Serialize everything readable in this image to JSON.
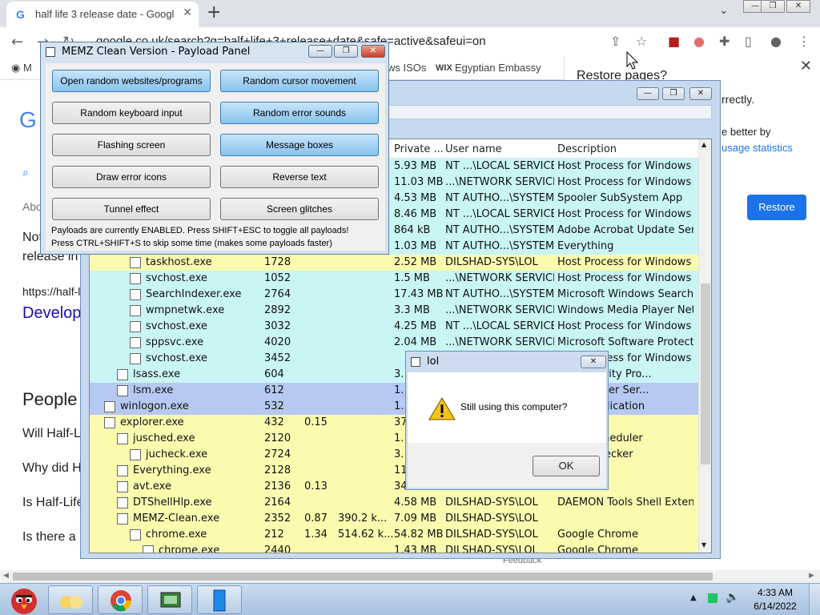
{
  "chrome": {
    "tab_title": "half life 3 release date - Googl",
    "tab_close": "✕",
    "new_tab": "+",
    "url": "google.co.uk/search?q=half+life+3+release+date&safe=active&safeui=on",
    "bookmarks": [
      "M",
      "ws ISOs",
      "Egyptian Embassy"
    ],
    "bookmark_wix": "WIX"
  },
  "page_behind": {
    "google_letter": "G",
    "about": "Abo",
    "not": "Not",
    "release": "release in",
    "url_snip": "https://half-l",
    "develop": "Develop",
    "people": "People",
    "q1": "Will Half-L",
    "q2": "Why did H",
    "q3": "Is Half-Life",
    "q4": "Is there a",
    "feedback": "Feedback"
  },
  "restore": {
    "title": "Restore pages?",
    "line1": "rrectly.",
    "line2": "e better by",
    "link": "usage statistics",
    "button": "Restore"
  },
  "taskmgr": {
    "columns": {
      "private": "Private ...",
      "user": "User name",
      "description": "Description"
    },
    "rows": [
      {
        "name": "",
        "pid": "",
        "cpu": "",
        "ws": "",
        "priv": "5.93 MB",
        "user": "NT ...\\LOCAL SERVICE",
        "desc": "Host Process for Windows ...",
        "color": "#c9f5f5",
        "indent": 2
      },
      {
        "name": "",
        "pid": "",
        "cpu": "",
        "ws": "",
        "priv": "11.03 MB",
        "user": "...\\NETWORK SERVICE",
        "desc": "Host Process for Windows ...",
        "color": "#c9f5f5",
        "indent": 2
      },
      {
        "name": "",
        "pid": "",
        "cpu": "",
        "ws": "",
        "priv": "4.53 MB",
        "user": "NT AUTHO...\\SYSTEM",
        "desc": "Spooler SubSystem App",
        "color": "#c9f5f5",
        "indent": 2
      },
      {
        "name": "",
        "pid": "",
        "cpu": "",
        "ws": "",
        "priv": "8.46 MB",
        "user": "NT ...\\LOCAL SERVICE",
        "desc": "Host Process for Windows ...",
        "color": "#c9f5f5",
        "indent": 2
      },
      {
        "name": "",
        "pid": "",
        "cpu": "",
        "ws": "",
        "priv": "864 kB",
        "user": "NT AUTHO...\\SYSTEM",
        "desc": "Adobe Acrobat Update Ser...",
        "color": "#c9f5f5",
        "indent": 2
      },
      {
        "name": "",
        "pid": "",
        "cpu": "",
        "ws": "",
        "priv": "1.03 MB",
        "user": "NT AUTHO...\\SYSTEM",
        "desc": "Everything",
        "color": "#c9f5f5",
        "indent": 2
      },
      {
        "name": "taskhost.exe",
        "pid": "1728",
        "cpu": "",
        "ws": "",
        "priv": "2.52 MB",
        "user": "DILSHAD-SYS\\LOL",
        "desc": "Host Process for Windows ...",
        "color": "#fbfbb0",
        "indent": 2
      },
      {
        "name": "svchost.exe",
        "pid": "1052",
        "cpu": "",
        "ws": "",
        "priv": "1.5 MB",
        "user": "...\\NETWORK SERVICE",
        "desc": "Host Process for Windows ...",
        "color": "#c9f5f5",
        "indent": 2
      },
      {
        "name": "SearchIndexer.exe",
        "pid": "2764",
        "cpu": "",
        "ws": "",
        "priv": "17.43 MB",
        "user": "NT AUTHO...\\SYSTEM",
        "desc": "Microsoft Windows Search...",
        "color": "#c9f5f5",
        "indent": 2
      },
      {
        "name": "wmpnetwk.exe",
        "pid": "2892",
        "cpu": "",
        "ws": "",
        "priv": "3.3 MB",
        "user": "...\\NETWORK SERVICE",
        "desc": "Windows Media Player Net...",
        "color": "#c9f5f5",
        "indent": 2
      },
      {
        "name": "svchost.exe",
        "pid": "3032",
        "cpu": "",
        "ws": "",
        "priv": "4.25 MB",
        "user": "NT ...\\LOCAL SERVICE",
        "desc": "Host Process for Windows ...",
        "color": "#c9f5f5",
        "indent": 2
      },
      {
        "name": "sppsvc.exe",
        "pid": "4020",
        "cpu": "",
        "ws": "",
        "priv": "2.04 MB",
        "user": "...\\NETWORK SERVICE",
        "desc": "Microsoft Software Protecti...",
        "color": "#c9f5f5",
        "indent": 2
      },
      {
        "name": "svchost.exe",
        "pid": "3452",
        "cpu": "",
        "ws": "",
        "priv": "",
        "user": "",
        "desc": "Host Process for Windows ...",
        "color": "#c9f5f5",
        "indent": 2
      },
      {
        "name": "lsass.exe",
        "pid": "604",
        "cpu": "",
        "ws": "",
        "priv": "3.",
        "user": "",
        "desc": "ity Authority Pro...",
        "color": "#c9f5f5",
        "indent": 1
      },
      {
        "name": "lsm.exe",
        "pid": "612",
        "cpu": "",
        "ws": "",
        "priv": "1.",
        "user": "",
        "desc": "on Manager Ser...",
        "color": "#b6c9f2",
        "indent": 1
      },
      {
        "name": "winlogon.exe",
        "pid": "532",
        "cpu": "",
        "ws": "",
        "priv": "1.",
        "user": "",
        "desc": "ogon Application",
        "color": "#b6c9f2",
        "indent": 0
      },
      {
        "name": "explorer.exe",
        "pid": "432",
        "cpu": "0.15",
        "ws": "",
        "priv": "37.",
        "user": "",
        "desc": "xplorer",
        "color": "#fbfbb0",
        "indent": 0
      },
      {
        "name": "jusched.exe",
        "pid": "2120",
        "cpu": "",
        "ws": "",
        "priv": "1.",
        "user": "",
        "desc": "pdate Scheduler",
        "color": "#fbfbb0",
        "indent": 1
      },
      {
        "name": "jucheck.exe",
        "pid": "2724",
        "cpu": "",
        "ws": "",
        "priv": "3.",
        "user": "",
        "desc": "pdate Checker",
        "color": "#fbfbb0",
        "indent": 2
      },
      {
        "name": "Everything.exe",
        "pid": "2128",
        "cpu": "",
        "ws": "",
        "priv": "11.",
        "user": "",
        "desc": "",
        "color": "#fbfbb0",
        "indent": 1
      },
      {
        "name": "avt.exe",
        "pid": "2136",
        "cpu": "0.13",
        "ws": "",
        "priv": "34.",
        "user": "",
        "desc": "",
        "color": "#fbfbb0",
        "indent": 1
      },
      {
        "name": "DTShellHlp.exe",
        "pid": "2164",
        "cpu": "",
        "ws": "",
        "priv": "4.58 MB",
        "user": "DILSHAD-SYS\\LOL",
        "desc": "DAEMON Tools Shell Exten...",
        "color": "#fbfbb0",
        "indent": 1
      },
      {
        "name": "MEMZ-Clean.exe",
        "pid": "2352",
        "cpu": "0.87",
        "ws": "390.2 k...",
        "priv": "7.09 MB",
        "user": "DILSHAD-SYS\\LOL",
        "desc": "",
        "color": "#fbfbb0",
        "indent": 1
      },
      {
        "name": "chrome.exe",
        "pid": "212",
        "cpu": "1.34",
        "ws": "514.62 k...",
        "priv": "54.82 MB",
        "user": "DILSHAD-SYS\\LOL",
        "desc": "Google Chrome",
        "color": "#fbfbb0",
        "indent": 2
      },
      {
        "name": "chrome.exe",
        "pid": "2440",
        "cpu": "",
        "ws": "",
        "priv": "1.43 MB",
        "user": "DILSHAD-SYS\\LOL",
        "desc": "Google Chrome",
        "color": "#fbfbb0",
        "indent": 3
      }
    ]
  },
  "memz": {
    "title": "MEMZ Clean Version - Payload Panel",
    "buttons": [
      {
        "label": "Open random websites/programs",
        "on": true
      },
      {
        "label": "Random cursor movement",
        "on": true
      },
      {
        "label": "Random keyboard input",
        "on": false
      },
      {
        "label": "Random error sounds",
        "on": true
      },
      {
        "label": "Flashing screen",
        "on": false
      },
      {
        "label": "Message boxes",
        "on": true
      },
      {
        "label": "Draw error icons",
        "on": false
      },
      {
        "label": "Reverse text",
        "on": false
      },
      {
        "label": "Tunnel effect",
        "on": false
      },
      {
        "label": "Screen glitches",
        "on": false
      }
    ],
    "msg1": "Payloads are currently ENABLED. Press SHIFT+ESC to toggle all payloads!",
    "msg2": "Press CTRL+SHIFT+S to skip some time (makes some payloads faster)"
  },
  "dialog": {
    "title": "lol",
    "message": "Still using this computer?",
    "ok": "OK"
  },
  "taskbar": {
    "time": "4:33 AM",
    "date": "6/14/2022"
  }
}
